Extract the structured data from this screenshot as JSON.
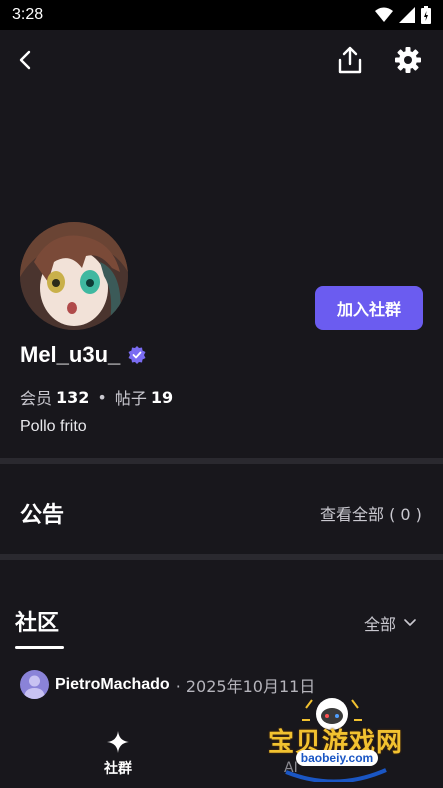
{
  "status_bar": {
    "time": "3:28"
  },
  "profile": {
    "name": "Mel_u3u_",
    "members_label": "会员",
    "members_count": "132",
    "posts_label": "帖子",
    "posts_count": "19",
    "separator": "•",
    "bio": "Pollo frito",
    "join_button": "加入社群"
  },
  "announcements": {
    "title": "公告",
    "view_all": "查看全部 ( 0 )"
  },
  "community": {
    "tab_label": "社区",
    "filter": "全部"
  },
  "post": {
    "author": "PietroMachado",
    "date": "· 2025年10月11日"
  },
  "bottom_nav": {
    "community_label": "社群",
    "ai_label": "AI"
  },
  "watermark": {
    "text": "宝贝游戏网",
    "sub": "baobeiy.com"
  },
  "colors": {
    "background": "#18171c",
    "accent": "#6b5cf0",
    "divider": "#2a292f"
  }
}
